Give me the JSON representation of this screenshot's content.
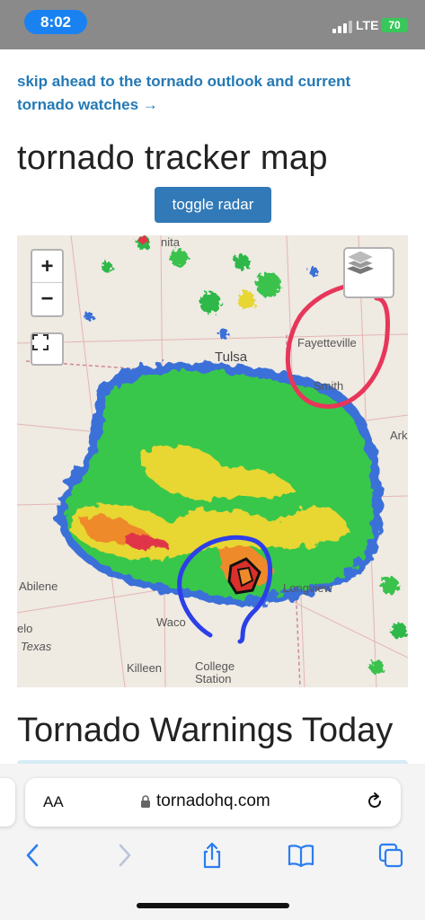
{
  "status_bar": {
    "time": "8:02",
    "network": "LTE",
    "battery": "70"
  },
  "page": {
    "skip_link": "skip ahead to the tornado outlook and current tornado watches →",
    "title": "tornado tracker map",
    "toggle_radar_label": "toggle radar",
    "section_heading": "Tornado Warnings Today"
  },
  "map": {
    "zoom_in": "+",
    "zoom_out": "−",
    "cities": {
      "tulsa": "Tulsa",
      "fayetteville": "Fayetteville",
      "fort_smith": "Smith",
      "arkansas": "Ark",
      "abilene": "Abilene",
      "waco": "Waco",
      "longview": "Longview",
      "killeen": "Killeen",
      "college_station": "College\nStation",
      "angelo": "elo",
      "texas": "Texas",
      "northwest": "nita"
    }
  },
  "browser": {
    "text_size": "AA",
    "url": "tornadohq.com"
  },
  "colors": {
    "accent": "#2479b5",
    "button": "#3279b7",
    "annotation_red": "#e8365a",
    "annotation_blue": "#2c3fe8"
  },
  "icons": [
    "zoom-in-icon",
    "zoom-out-icon",
    "fullscreen-icon",
    "layers-icon",
    "lock-icon",
    "reload-icon",
    "back-icon",
    "forward-icon",
    "share-icon",
    "bookmarks-icon",
    "tabs-icon"
  ]
}
